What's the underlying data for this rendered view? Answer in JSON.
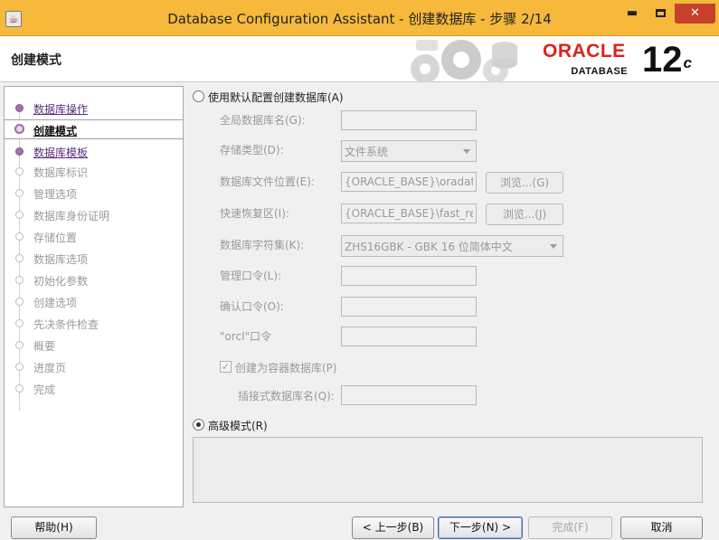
{
  "window": {
    "title": "Database Configuration Assistant - 创建数据库 - 步骤 2/14",
    "minimize": "▬",
    "close": "✕"
  },
  "banner": {
    "page_title": "创建模式",
    "oracle_word": "ORACLE",
    "oracle_sub": "DATABASE",
    "version_main": "12",
    "version_sup": "c"
  },
  "nav": {
    "items": [
      {
        "label": "数据库操作",
        "state": "done"
      },
      {
        "label": "创建模式",
        "state": "current"
      },
      {
        "label": "数据库模板",
        "state": "done"
      },
      {
        "label": "数据库标识",
        "state": "pending"
      },
      {
        "label": "管理选项",
        "state": "pending"
      },
      {
        "label": "数据库身份证明",
        "state": "pending"
      },
      {
        "label": "存储位置",
        "state": "pending"
      },
      {
        "label": "数据库选项",
        "state": "pending"
      },
      {
        "label": "初始化参数",
        "state": "pending"
      },
      {
        "label": "创建选项",
        "state": "pending"
      },
      {
        "label": "先决条件检查",
        "state": "pending"
      },
      {
        "label": "概要",
        "state": "pending"
      },
      {
        "label": "进度页",
        "state": "pending"
      },
      {
        "label": "完成",
        "state": "pending"
      }
    ]
  },
  "main": {
    "default_mode_label": "使用默认配置创建数据库(A)",
    "default_mode_selected": false,
    "global_db_name": {
      "label": "全局数据库名(G):",
      "value": ""
    },
    "storage_type": {
      "label": "存储类型(D):",
      "value": "文件系统"
    },
    "db_file_location": {
      "label": "数据库文件位置(E):",
      "value": "{ORACLE_BASE}\\oradata",
      "browse": "浏览...(G)"
    },
    "fast_recovery": {
      "label": "快速恢复区(I):",
      "value": "{ORACLE_BASE}\\fast_recov",
      "browse": "浏览...(J)"
    },
    "charset": {
      "label": "数据库字符集(K):",
      "value": "ZHS16GBK - GBK 16 位简体中文"
    },
    "admin_password": {
      "label": "管理口令(L):",
      "value": ""
    },
    "confirm_password": {
      "label": "确认口令(O):",
      "value": ""
    },
    "orcl_password": {
      "label": "\"orcl\"口令",
      "value": ""
    },
    "container_db": {
      "label": "创建为容器数据库(P)",
      "checked": true,
      "check_glyph": "✓"
    },
    "pluggable_name": {
      "label": "插接式数据库名(Q):",
      "value": ""
    },
    "advanced_mode_label": "高级模式(R)",
    "advanced_mode_selected": true
  },
  "buttons": {
    "help": "帮助(H)",
    "back": "< 上一步(B)",
    "next": "下一步(N) >",
    "finish": "完成(F)",
    "cancel": "取消"
  },
  "colors": {
    "titlebar": "#f6b93b",
    "close_button": "#c7412a",
    "oracle_red": "#e0201b",
    "nav_done": "#5a2d7a"
  }
}
